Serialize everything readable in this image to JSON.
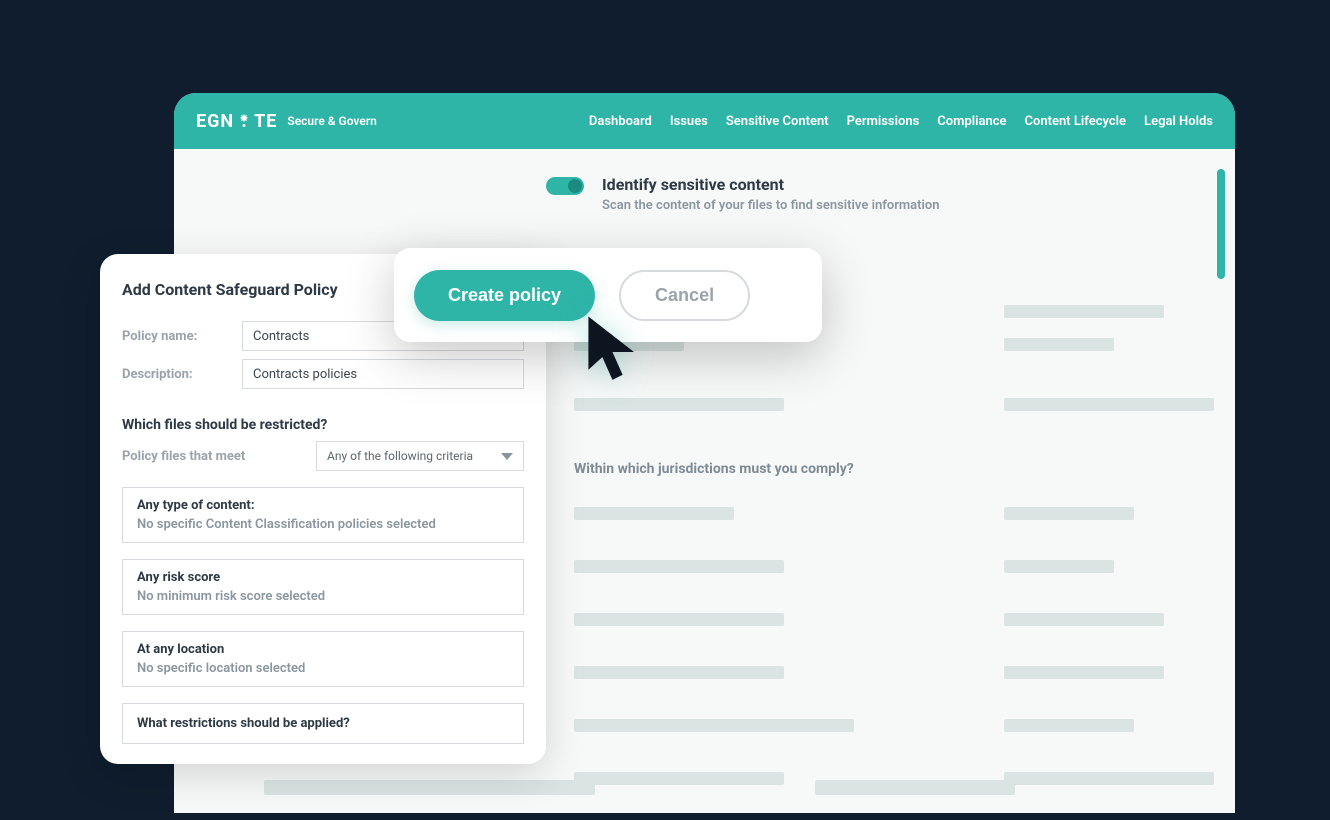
{
  "brand": {
    "name": "EGNYTE",
    "sub": "Secure & Govern"
  },
  "nav": [
    "Dashboard",
    "Issues",
    "Sensitive Content",
    "Permissions",
    "Compliance",
    "Content Lifecycle",
    "Legal Holds"
  ],
  "toggle": {
    "title": "Identify sensitive content",
    "sub": "Scan the content of your files to find sensitive information"
  },
  "jurisdictions_label": "Within which jurisdictions must you comply?",
  "popover": {
    "title": "Add Content Safeguard Policy",
    "policy_name_label": "Policy name:",
    "policy_name_value": "Contracts",
    "description_label": "Description:",
    "description_value": "Contracts policies",
    "restrict_label": "Which files should be restricted?",
    "meet_label": "Policy files that meet",
    "meet_value": "Any of the following criteria",
    "criteria": [
      {
        "title": "Any type of content:",
        "sub": "No specific Content Classification policies selected"
      },
      {
        "title": "Any risk score",
        "sub": "No minimum risk score selected"
      },
      {
        "title": "At any location",
        "sub": "No specific location selected"
      }
    ],
    "restrictions_label": "What restrictions should be applied?"
  },
  "actions": {
    "create": "Create policy",
    "cancel": "Cancel"
  }
}
